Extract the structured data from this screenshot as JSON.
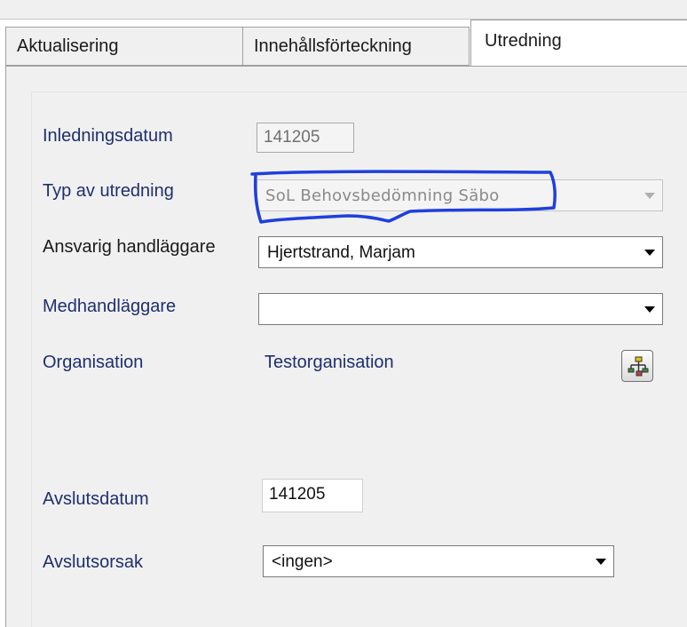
{
  "tabs": [
    {
      "label": "Aktualisering"
    },
    {
      "label": "Innehållsförteckning"
    },
    {
      "label": "Utredning"
    }
  ],
  "form": {
    "inledningsdatum": {
      "label": "Inledningsdatum",
      "value": "141205"
    },
    "typ_av_utredning": {
      "label": "Typ av utredning",
      "value": "SoL Behovsbedömning Säbo"
    },
    "ansvarig_handlaggare": {
      "label": "Ansvarig handläggare",
      "value": "Hjertstrand, Marjam"
    },
    "medhandlaggare": {
      "label": "Medhandläggare",
      "value": ""
    },
    "organisation": {
      "label": "Organisation",
      "value": "Testorganisation",
      "button_icon": "org-chart-icon"
    },
    "avslutsdatum": {
      "label": "Avslutsdatum",
      "value": "141205"
    },
    "avslutsorsak": {
      "label": "Avslutsorsak",
      "value": "<ingen>"
    }
  },
  "colors": {
    "label_blue": "#1f2f6e",
    "annotation_blue": "#1f3fdd",
    "panel_bg": "#f0f0f0"
  }
}
